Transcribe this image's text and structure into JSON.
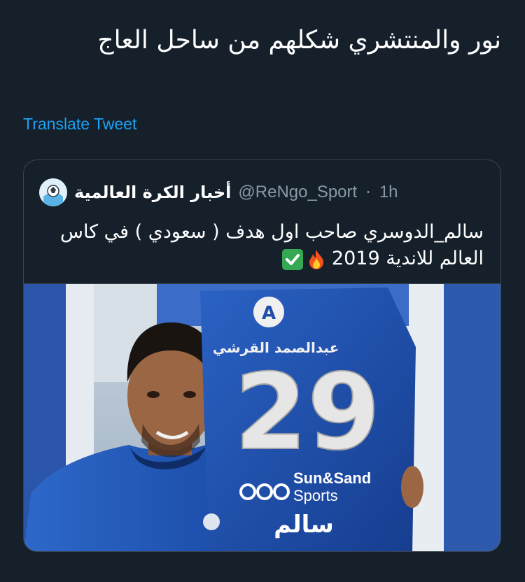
{
  "tweet": {
    "text": "نور والمنتشري شكلهم من ساحل العاج",
    "translate_label": "Translate Tweet"
  },
  "quoted_tweet": {
    "author_name": "أخبار الكرة العالمية",
    "handle": "@ReNgo_Sport",
    "separator": "·",
    "time": "1h",
    "text_line1": "سالم_الدوسري صاحب اول هدف ( سعودي ) في كاس",
    "text_line2": "العالم للاندية 2019",
    "icons": [
      "football-avatar-icon",
      "fire-icon",
      "check-mark-icon"
    ]
  },
  "photo": {
    "jersey_sponsor_arabic": "عبدالصمد القرشي",
    "jersey_number": "29",
    "jersey_sponsor_line1": "Sun&Sand",
    "jersey_sponsor_line2": "Sports",
    "jersey_name_arabic": "سالم",
    "jersey_color": "#1f4fa8",
    "jersey_logo_letter": "A"
  },
  "colors": {
    "background": "#15202b",
    "link": "#1da1f2",
    "muted": "#8899a6",
    "border": "#38444d"
  }
}
